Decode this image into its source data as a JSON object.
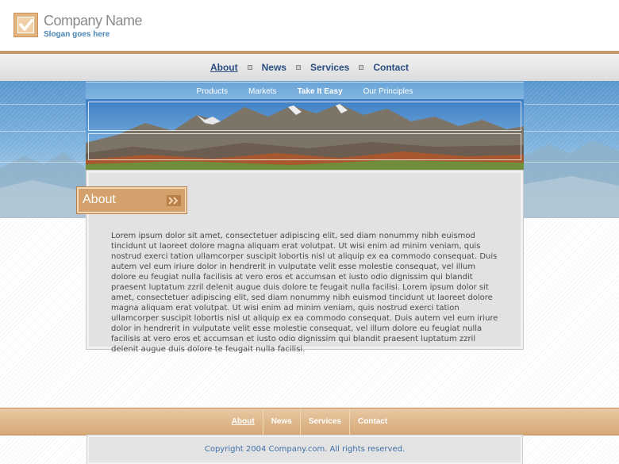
{
  "header": {
    "company_name": "Company Name",
    "slogan": "Slogan goes here",
    "logo_icon": "checkmark-icon"
  },
  "top_nav": [
    {
      "label": "About",
      "active": true
    },
    {
      "label": "News",
      "active": false
    },
    {
      "label": "Services",
      "active": false
    },
    {
      "label": "Contact",
      "active": false
    }
  ],
  "sub_nav": [
    {
      "label": "Products",
      "bold": false
    },
    {
      "label": "Markets",
      "bold": false
    },
    {
      "label": "Take It Easy",
      "bold": true
    },
    {
      "label": "Our Principles",
      "bold": false
    }
  ],
  "section": {
    "title": "About",
    "title_icon": "double-chevron-right-icon",
    "body": "Lorem ipsum dolor sit amet, consectetuer adipiscing elit, sed diam nonummy nibh euismod tincidunt ut laoreet dolore magna aliquam erat volutpat. Ut wisi enim ad minim veniam, quis nostrud exerci tation ullamcorper suscipit lobortis nisl ut aliquip ex ea commodo consequat. Duis autem vel eum iriure dolor in hendrerit in vulputate velit esse molestie consequat, vel illum dolore eu feugiat nulla facilisis at vero eros et accumsan et iusto odio dignissim qui blandit praesent luptatum zzril delenit augue duis dolore te feugait nulla facilisi. Lorem ipsum dolor sit amet, consectetuer adipiscing elit, sed diam nonummy nibh euismod tincidunt ut laoreet dolore magna aliquam erat volutpat. Ut wisi enim ad minim veniam, quis nostrud exerci tation ullamcorper suscipit lobortis nisl ut aliquip ex ea commodo consequat. Duis autem vel eum iriure dolor in hendrerit in vulputate velit esse molestie consequat, vel illum dolore eu feugiat nulla facilisis at vero eros et accumsan et iusto odio dignissim qui blandit praesent luptatum zzril delenit augue duis dolore te feugait nulla facilisi."
  },
  "footer_nav": [
    {
      "label": "About",
      "active": true
    },
    {
      "label": "News",
      "active": false
    },
    {
      "label": "Services",
      "active": false
    },
    {
      "label": "Contact",
      "active": false
    }
  ],
  "copyright": "Copyright 2004 Company.com. All rights reserved.",
  "colors": {
    "accent_tan": "#d4a06b",
    "nav_link": "#2b4e82",
    "sky_blue": "#6aa5d8",
    "copyright_text": "#3f6fa8"
  }
}
